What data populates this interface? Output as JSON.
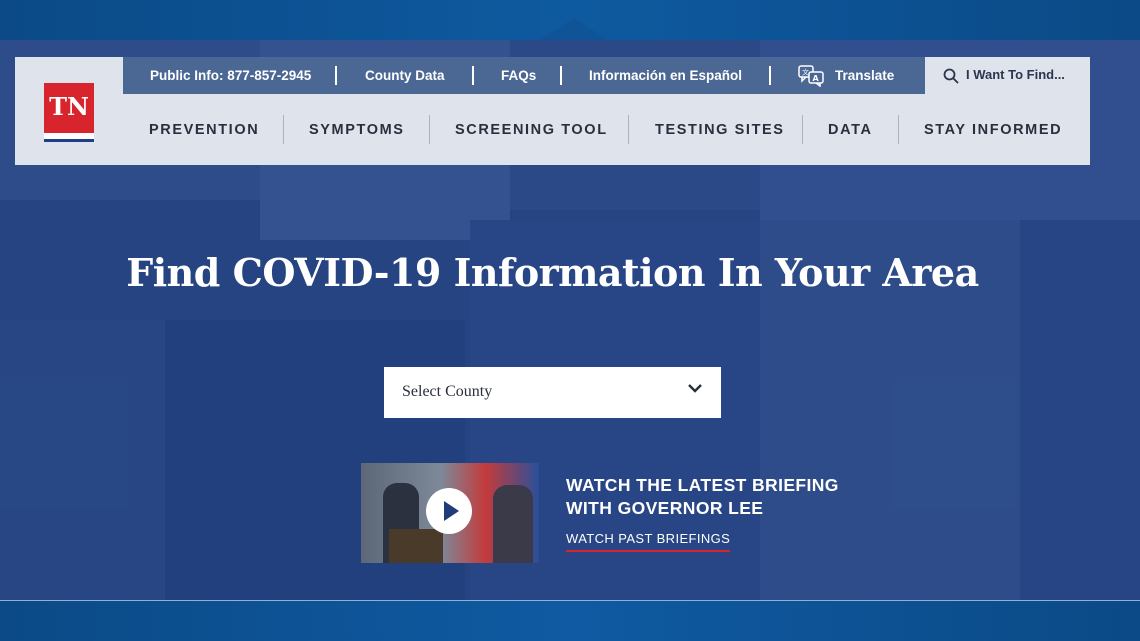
{
  "utility": {
    "phone": "Public Info: 877-857-2945",
    "county_data": "County Data",
    "faqs": "FAQs",
    "spanish": "Información en Español",
    "translate": "Translate",
    "find": "I Want To Find..."
  },
  "logo": {
    "text": "TN"
  },
  "nav": [
    "PREVENTION",
    "SYMPTOMS",
    "SCREENING TOOL",
    "TESTING SITES",
    "DATA",
    "STAY INFORMED"
  ],
  "hero": {
    "headline": "Find COVID-19 Information In Your Area",
    "select_label": "Select County",
    "briefing_title": "WATCH THE LATEST BRIEFING WITH GOVERNOR LEE",
    "briefing_link": "WATCH PAST BRIEFINGS"
  },
  "colors": {
    "navy": "#2b4a86",
    "red": "#d8242c",
    "utility_bar": "#4b6794",
    "nav_bg": "#dfe3ec"
  },
  "icons": {
    "search": "search-icon",
    "translate": "translate-icon",
    "chevron": "chevron-down-icon",
    "play": "play-icon"
  }
}
